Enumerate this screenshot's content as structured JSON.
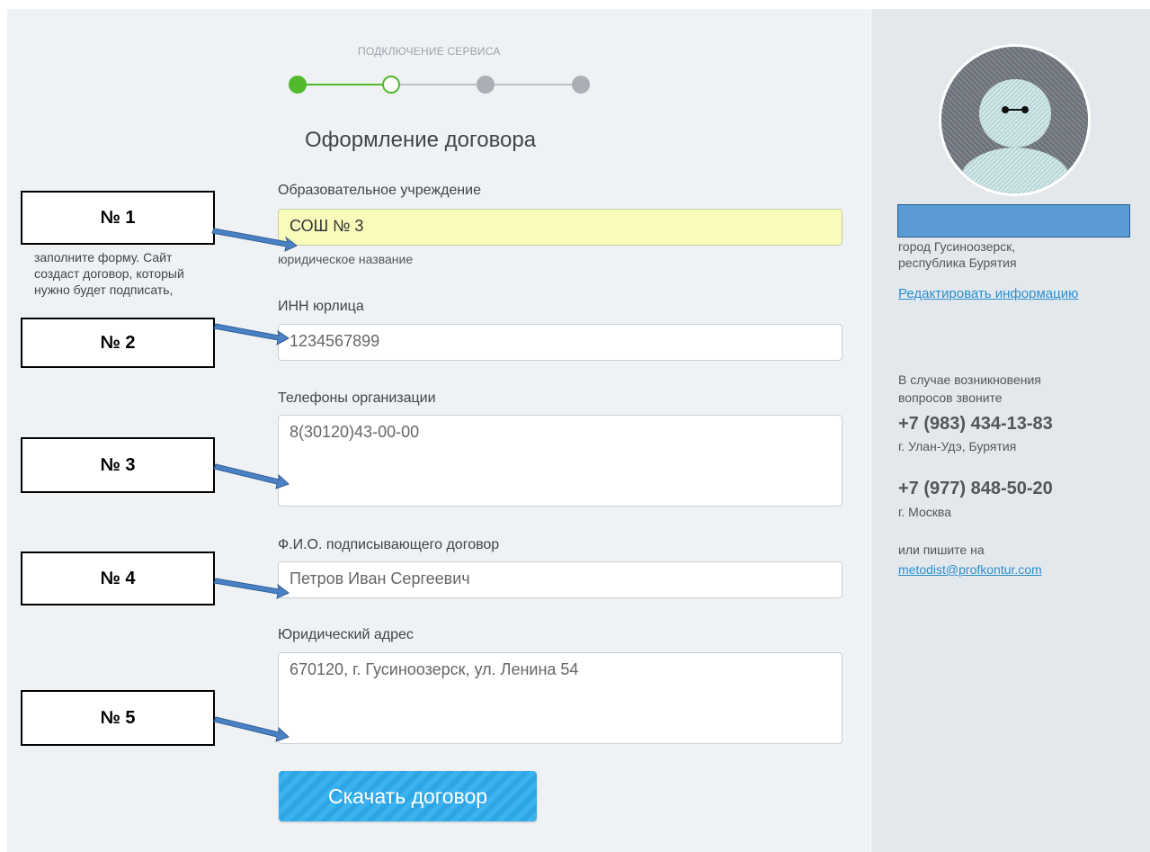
{
  "header": {
    "step_title": "ПОДКЛЮЧЕНИЕ СЕРВИСА",
    "heading": "Оформление договора"
  },
  "form": {
    "institution": {
      "label": "Образовательное учреждение",
      "value": "СОШ № 3",
      "hint": "юридическое название"
    },
    "inn": {
      "label": "ИНН юрлица",
      "value": "1234567899"
    },
    "phones": {
      "label": "Телефоны организации",
      "value": "8(30120)43-00-00"
    },
    "signer": {
      "label": "Ф.И.О. подписывающего договор",
      "value": "Петров Иван Сергеевич"
    },
    "address": {
      "label": "Юридический адрес",
      "value": "670120, г. Гусиноозерск, ул. Ленина 54"
    },
    "download_label": "Скачать договор"
  },
  "left_description": [
    "заполните форму. Сайт",
    "создаст договор, который",
    "нужно будет подписать,"
  ],
  "callouts": [
    "№ 1",
    "№ 2",
    "№ 3",
    "№ 4",
    "№ 5"
  ],
  "sidebar": {
    "city": "город Гусиноозерск,",
    "region": "республика Бурятия",
    "edit_link": "Редактировать информацию",
    "contact_intro_1": "В случае возникновения",
    "contact_intro_2": "вопросов звоните",
    "phone1": "+7 (983) 434-13-83",
    "phone1_city": "г. Улан-Удэ, Бурятия",
    "phone2": "+7 (977) 848-50-20",
    "phone2_city": "г. Москва",
    "write_to": "или пишите на",
    "email": "metodist@profkontur.com"
  },
  "colors": {
    "accent_green": "#52b92b",
    "step_gray": "#a9afb4",
    "button_blue": "#2ea6e6",
    "callout_arrow": "#4a80c4",
    "redaction": "#5b9bd5"
  }
}
